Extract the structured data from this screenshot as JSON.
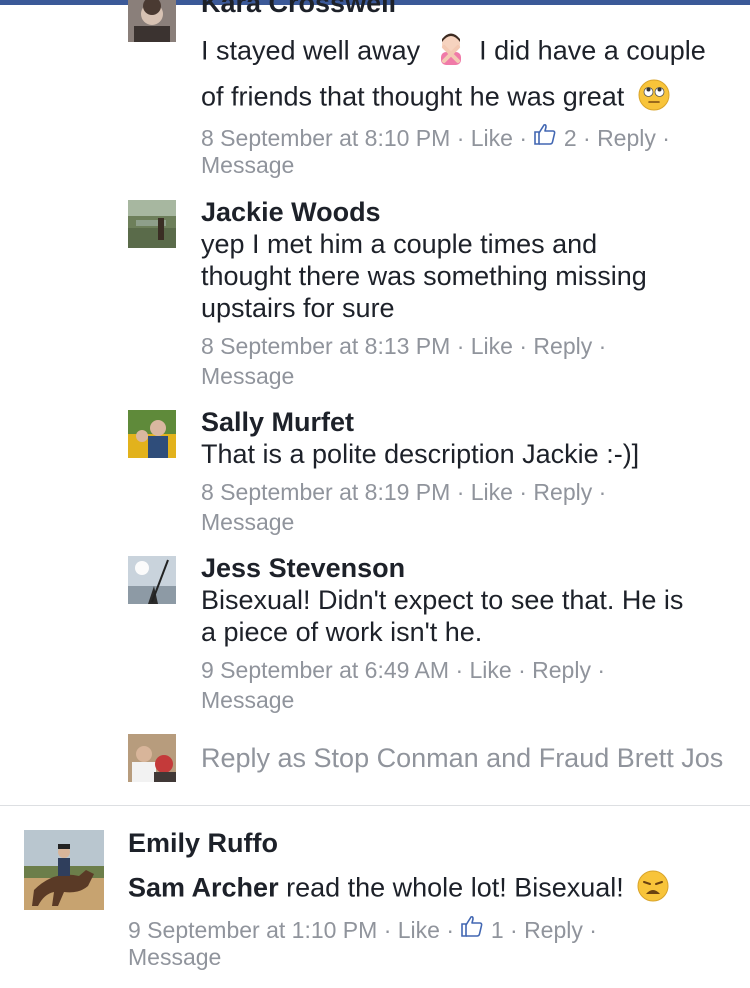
{
  "comments": [
    {
      "author": "Kara Crosswell",
      "line1": "I stayed well away",
      "line1b": "I did have a couple",
      "line2": "of friends that thought he was great",
      "time": "8 September at 8:10 PM",
      "like": "Like",
      "like_count": "2",
      "reply": "Reply",
      "message": "Message"
    },
    {
      "author": "Jackie Woods",
      "lines": [
        "yep I met him a couple times and",
        "thought there was something missing",
        "upstairs for sure"
      ],
      "time": "8 September at 8:13 PM",
      "like": "Like",
      "reply": "Reply",
      "message": "Message"
    },
    {
      "author": "Sally Murfet",
      "lines": [
        "That is a polite description Jackie :-)]"
      ],
      "time": "8 September at 8:19 PM",
      "like": "Like",
      "reply": "Reply",
      "message": "Message"
    },
    {
      "author": "Jess Stevenson",
      "lines": [
        "Bisexual! Didn't expect to see that. He is",
        "a piece of work isn't he."
      ],
      "time": "9 September at 6:49 AM",
      "like": "Like",
      "reply": "Reply",
      "message": "Message"
    }
  ],
  "reply_prompt": "Reply as Stop Conman and Fraud Brett Jos",
  "top_comment": {
    "author": "Emily Ruffo",
    "mention": "Sam Archer",
    "text": " read the whole lot! Bisexual!",
    "time": "9 September at 1:10 PM",
    "like": "Like",
    "like_count": "1",
    "reply": "Reply",
    "message": "Message"
  },
  "colors": {
    "meta": "#90949c",
    "text": "#1d2129",
    "like_blue": "#4267b2"
  }
}
